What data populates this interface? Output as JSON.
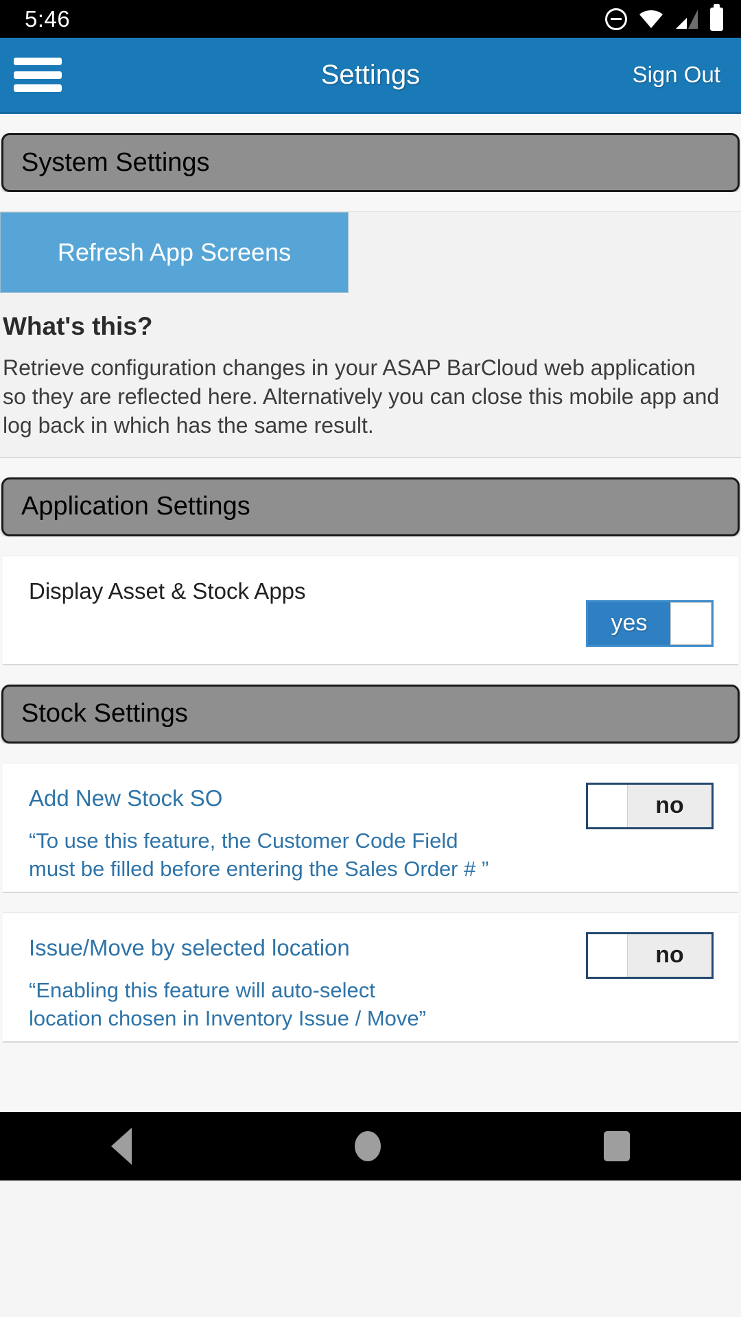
{
  "status_bar": {
    "time": "5:46",
    "icons": [
      "do-not-disturb-icon",
      "wifi-icon",
      "cellular-signal-icon",
      "battery-icon"
    ]
  },
  "app_bar": {
    "menu_icon": "hamburger-menu-icon",
    "title": "Settings",
    "sign_out_label": "Sign Out",
    "background_color": "#1a7ab8"
  },
  "sections": {
    "system": {
      "header": "System Settings",
      "refresh_button_label": "Refresh App Screens",
      "whats_this_title": "What's this?",
      "whats_this_body": "Retrieve configuration changes in your ASAP BarCloud web application so they are reflected here. Alternatively you can close this mobile app and log back in which has the same result."
    },
    "application": {
      "header": "Application Settings",
      "rows": [
        {
          "label": "Display Asset & Stock Apps",
          "toggle_value": "yes",
          "toggle_state": "on"
        }
      ]
    },
    "stock": {
      "header": "Stock Settings",
      "rows": [
        {
          "label": "Add New Stock SO",
          "toggle_value": "no",
          "toggle_state": "off",
          "note_line1": "“To use this feature, the Customer Code Field",
          "note_line2": "must be filled before entering the Sales Order # ”"
        },
        {
          "label": "Issue/Move by selected location",
          "toggle_value": "no",
          "toggle_state": "off",
          "note_line1": "“Enabling this feature will auto-select",
          "note_line2": "location chosen in Inventory Issue / Move”"
        }
      ]
    }
  },
  "nav_bar": {
    "back_icon": "back-triangle-icon",
    "home_icon": "home-circle-icon",
    "recents_icon": "recents-square-icon"
  },
  "colors": {
    "accent_blue": "#1a7ab8",
    "button_blue": "#57a5d6",
    "toggle_on_blue": "#2e80c2",
    "link_blue": "#2e74a8",
    "header_gray": "#8f8f8f"
  }
}
